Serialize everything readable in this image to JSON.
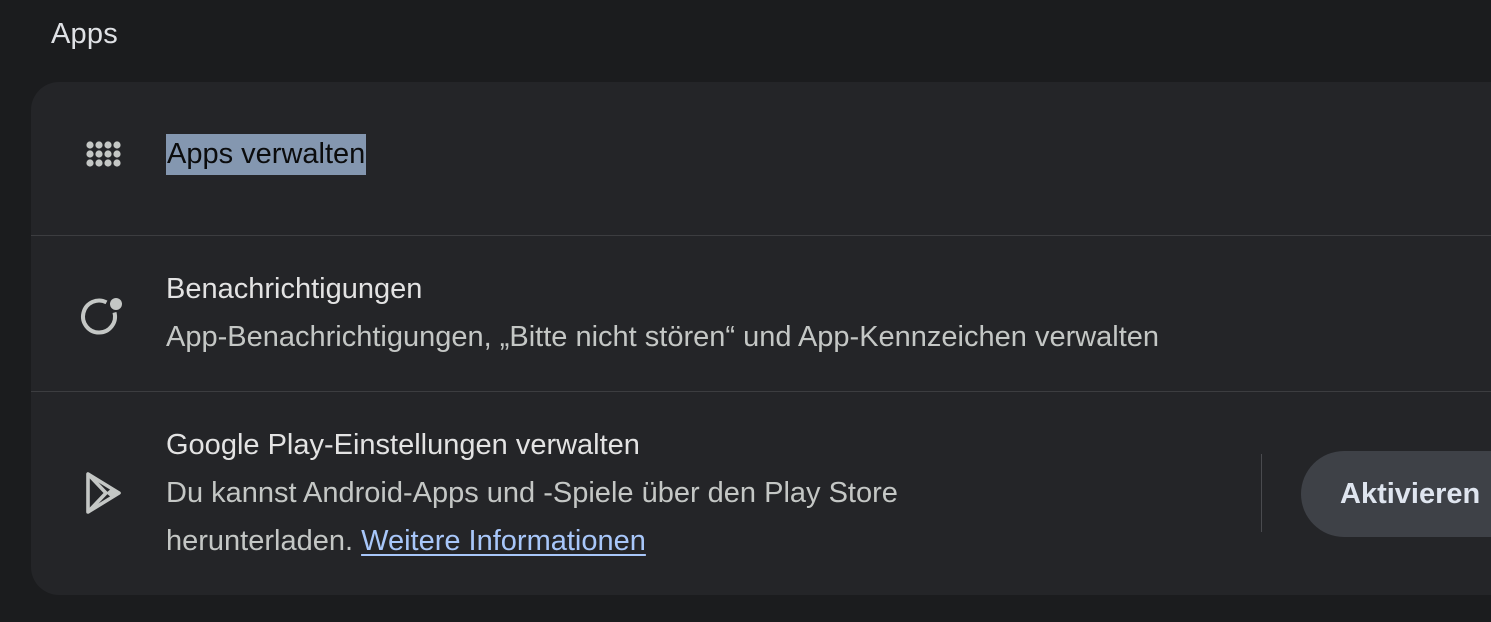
{
  "section": {
    "title": "Apps"
  },
  "rows": [
    {
      "icon": "apps-grid-icon",
      "title": "Apps verwalten"
    },
    {
      "icon": "notifications-icon",
      "title": "Benachrichtigungen",
      "subtitle": "App-Benachrichtigungen, „Bitte nicht stören“ und App-Kennzeichen verwalten"
    },
    {
      "icon": "google-play-icon",
      "title": "Google Play-Einstellungen verwalten",
      "subtitle_line1": "Du kannst Android-Apps und -Spiele über den Play Store",
      "subtitle_line2": "herunterladen.",
      "link": "Weitere Informationen",
      "button": "Aktivieren"
    }
  ],
  "colors": {
    "background": "#1b1c1e",
    "card": "#242528",
    "selection": "#8497b0",
    "link": "#a8c7fa",
    "button": "#3e4147"
  }
}
